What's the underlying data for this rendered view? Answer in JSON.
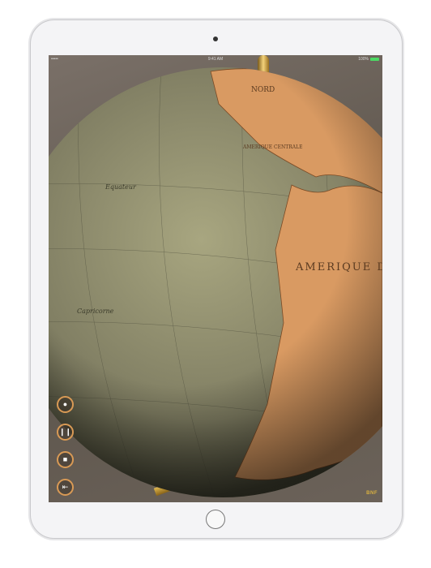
{
  "status_bar": {
    "signal": "•••••",
    "time": "9:41 AM",
    "battery": "100%"
  },
  "map_labels": {
    "equator": "Equateur",
    "capricorn": "Capricorne",
    "north": "NORD",
    "south_america": "AMERIQUE DU SUD",
    "central": "AMERIQUE CENTRALE"
  },
  "controls": [
    {
      "name": "light",
      "icon": "lightbulb-icon"
    },
    {
      "name": "layers",
      "icon": "layers-icon"
    },
    {
      "name": "view",
      "icon": "camera-icon"
    },
    {
      "name": "exit",
      "icon": "exit-icon"
    }
  ],
  "logo": "BNF",
  "colors": {
    "ocean": "#8c8a6c",
    "land": "#d99a62",
    "accent": "#d99a55"
  }
}
